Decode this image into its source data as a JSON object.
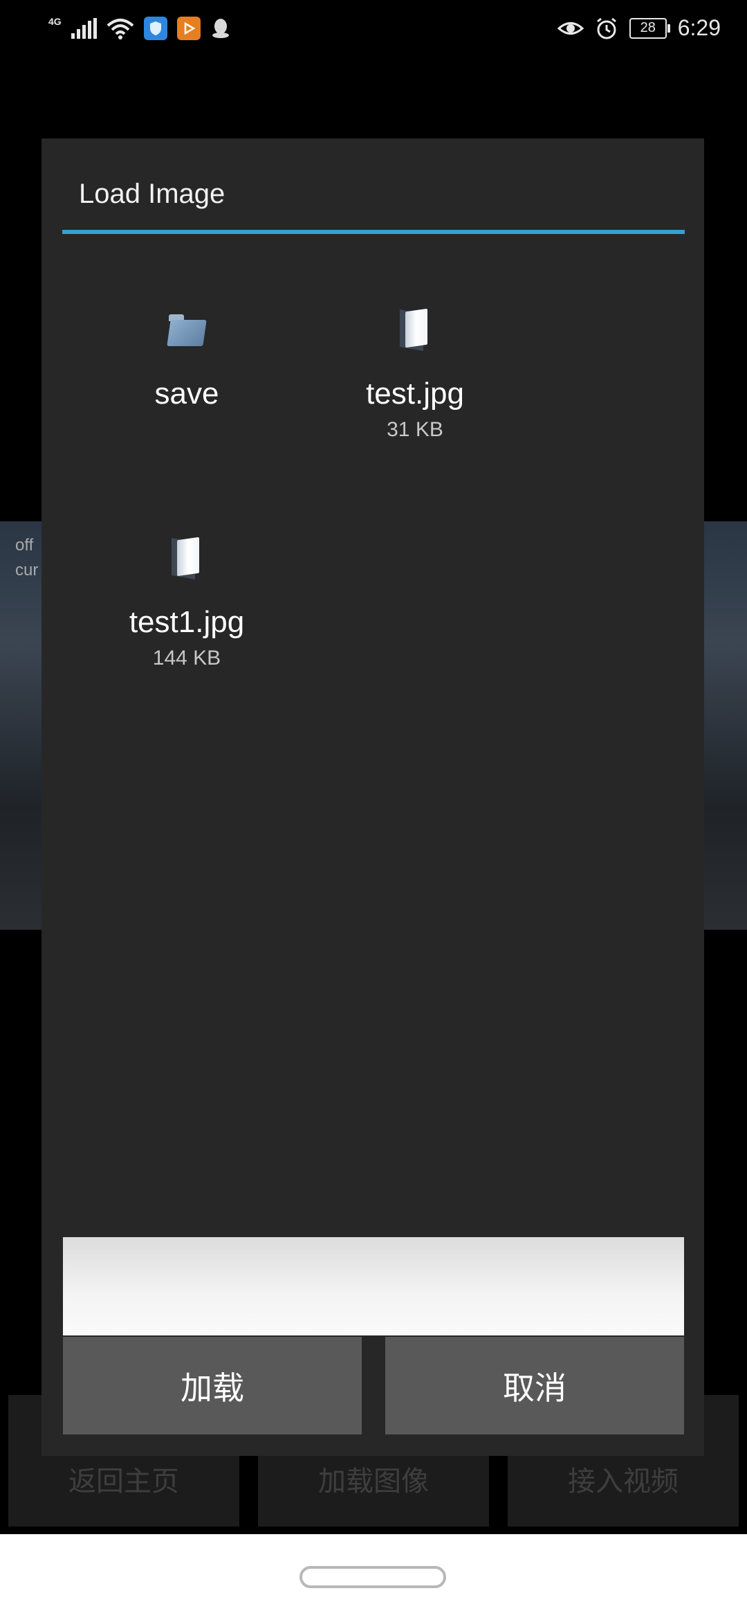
{
  "status_bar": {
    "network": "4G",
    "battery": "28",
    "time": "6:29",
    "icons": [
      "signal-icon",
      "wifi-icon",
      "shield-app-icon",
      "play-app-icon",
      "qq-icon",
      "eye-icon",
      "alarm-icon",
      "battery-icon"
    ]
  },
  "background_app": {
    "overlay_text": [
      "off",
      "cur"
    ],
    "buttons": [
      "返回主页",
      "加载图像",
      "接入视频"
    ]
  },
  "dialog": {
    "title": "Load Image",
    "accent_color": "#33a1d6",
    "files": [
      {
        "name": "save",
        "size": "",
        "type": "folder-icon"
      },
      {
        "name": "test.jpg",
        "size": "31 KB",
        "type": "file-icon"
      },
      {
        "name": "test1.jpg",
        "size": "144 KB",
        "type": "file-icon"
      }
    ],
    "filename_input": {
      "value": "",
      "placeholder": ""
    },
    "load_button": "加载",
    "cancel_button": "取消"
  }
}
